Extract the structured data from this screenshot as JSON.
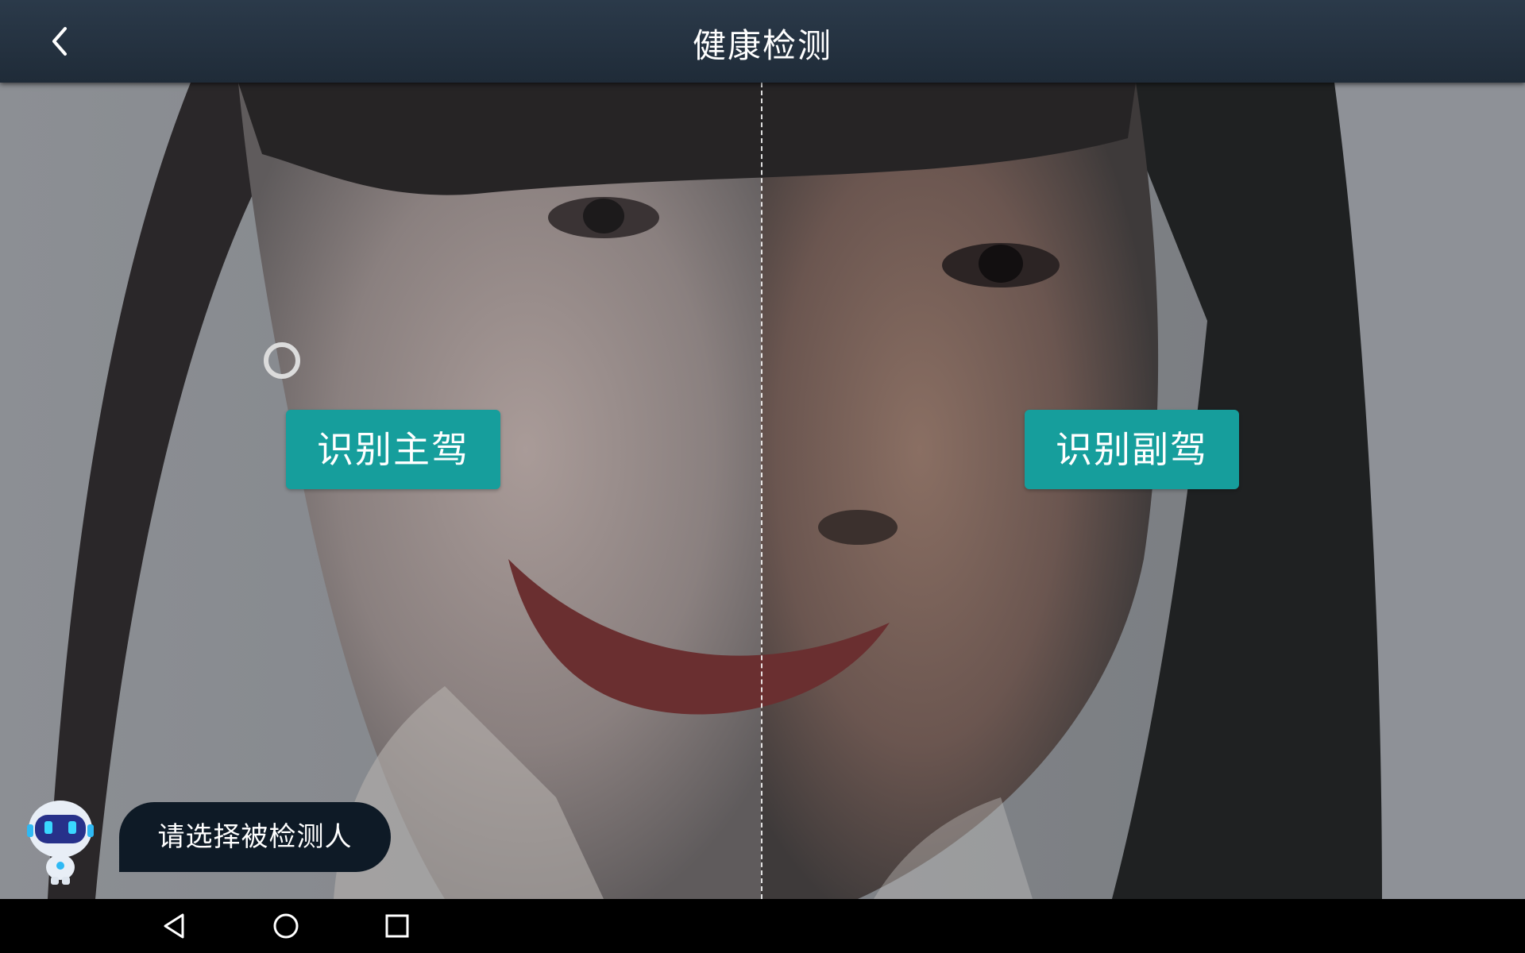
{
  "header": {
    "title": "健康检测",
    "back_icon": "chevron-left-icon"
  },
  "preview": {
    "driver_button_label": "识别主驾",
    "copilot_button_label": "识别副驾",
    "accent_color": "#169e9c"
  },
  "assistant": {
    "icon": "robot-assistant-icon",
    "message": "请选择被检测人"
  },
  "navbar": {
    "back_icon": "triangle-back-icon",
    "home_icon": "circle-home-icon",
    "recent_icon": "square-recent-icon"
  }
}
